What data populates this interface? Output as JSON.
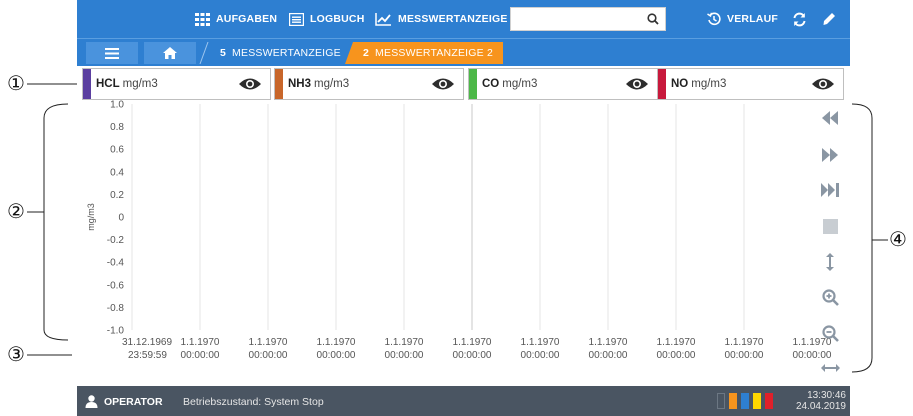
{
  "topnav": {
    "tasks_label": "AUFGABEN",
    "logbook_label": "LOGBUCH",
    "measure_label": "MESSWERTANZEIGE",
    "search_value": "",
    "history_label": "VERLAUF"
  },
  "breadcrumb": {
    "crumb1_num": "5",
    "crumb1_label": "MESSWERTANZEIGE",
    "crumb2_num": "2",
    "crumb2_label": "MESSWERTANZEIGE 2"
  },
  "channels": [
    {
      "name": "HCL",
      "unit": "mg/m3",
      "color": "#5b3fa0"
    },
    {
      "name": "NH3",
      "unit": "mg/m3",
      "color": "#c8662a"
    },
    {
      "name": "CO",
      "unit": "mg/m3",
      "color": "#4cb848"
    },
    {
      "name": "NO",
      "unit": "mg/m3",
      "color": "#c8193c"
    }
  ],
  "annotations": {
    "c1": "①",
    "c2": "②",
    "c3": "③",
    "c4": "④"
  },
  "chart_data": {
    "type": "line",
    "ylabel": "mg/m3",
    "ylim": [
      -1.0,
      1.0
    ],
    "y_ticks": [
      "1.0",
      "0.8",
      "0.6",
      "0.4",
      "0.2",
      "0",
      "-0.2",
      "-0.4",
      "-0.6",
      "-0.8",
      "-1.0"
    ],
    "x_ticks": [
      {
        "date": "31.12.1969",
        "time": "23:59:59"
      },
      {
        "date": "1.1.1970",
        "time": "00:00:00"
      },
      {
        "date": "1.1.1970",
        "time": "00:00:00"
      },
      {
        "date": "1.1.1970",
        "time": "00:00:00"
      },
      {
        "date": "1.1.1970",
        "time": "00:00:00"
      },
      {
        "date": "1.1.1970",
        "time": "00:00:00"
      },
      {
        "date": "1.1.1970",
        "time": "00:00:00"
      },
      {
        "date": "1.1.1970",
        "time": "00:00:00"
      },
      {
        "date": "1.1.1970",
        "time": "00:00:00"
      },
      {
        "date": "1.1.1970",
        "time": "00:00:00"
      },
      {
        "date": "1.1.1970",
        "time": "00:00:00"
      }
    ],
    "series": [],
    "grid": true
  },
  "toolbar": {
    "icons": [
      "rewind-icon",
      "fast-forward-icon",
      "skip-end-icon",
      "stop-icon",
      "vertical-resize-icon",
      "zoom-in-icon",
      "zoom-out-icon",
      "horizontal-resize-icon"
    ]
  },
  "status": {
    "user": "OPERATOR",
    "state": "Betriebszustand: System Stop",
    "time": "13:30:46",
    "date": "24.04.2019",
    "led_colors": [
      "#4a5562",
      "#f7941d",
      "#2e7fd1",
      "#ffd800",
      "#e0202a"
    ]
  }
}
